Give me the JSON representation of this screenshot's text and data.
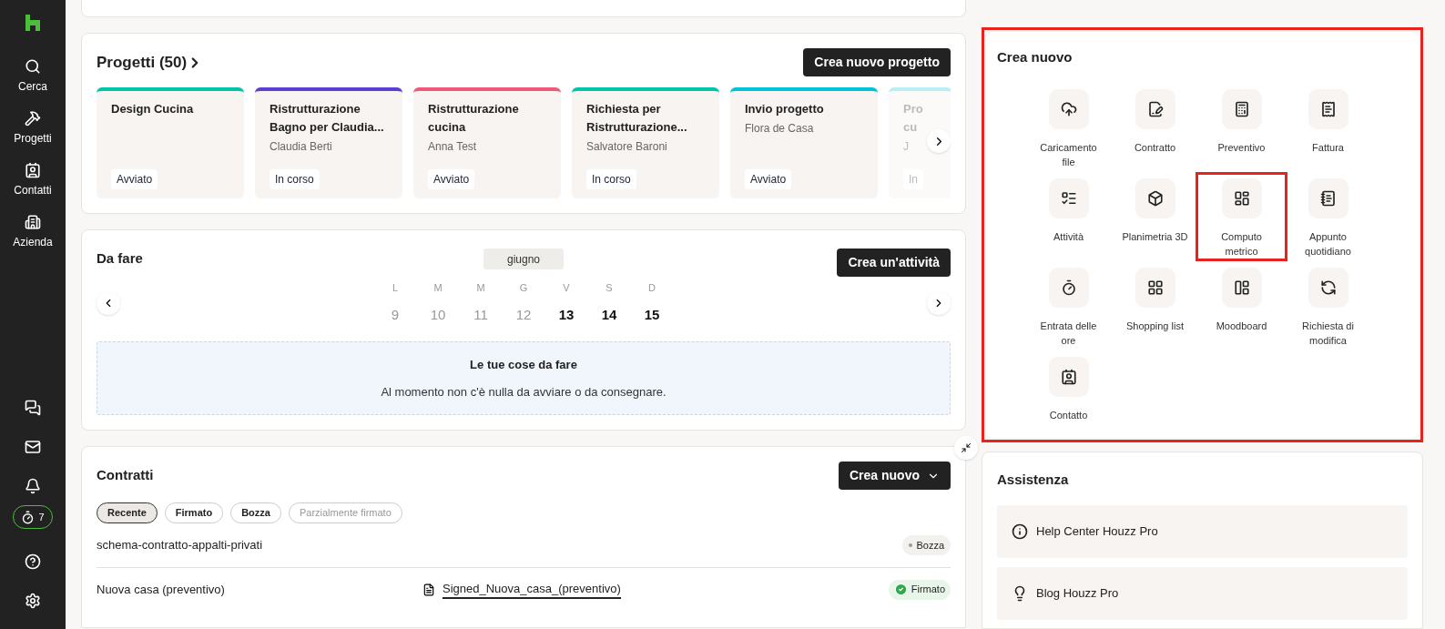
{
  "sidebar": {
    "items": [
      {
        "label": "Cerca"
      },
      {
        "label": "Progetti"
      },
      {
        "label": "Contatti"
      },
      {
        "label": "Azienda"
      }
    ],
    "timer_badge": "7"
  },
  "projects": {
    "title": "Progetti (50)",
    "button": "Crea nuovo progetto",
    "cards": [
      {
        "title": "Design Cucina",
        "status": "Avviato",
        "color": "#00c4a7",
        "faded": false
      },
      {
        "title": "Ristrutturazione Bagno per Claudia...",
        "client": "Claudia Berti",
        "status": "In corso",
        "color": "#5a3fd0",
        "faded": false
      },
      {
        "title": "Ristrutturazione cucina",
        "client": "Anna Test",
        "status": "Avviato",
        "color": "#f0587a",
        "faded": false
      },
      {
        "title": "Richiesta per Ristrutturazione...",
        "client": "Salvatore Baroni",
        "status": "In corso",
        "color": "#00c4a7",
        "faded": false
      },
      {
        "title": "Invio progetto",
        "client": "Flora de Casa",
        "status": "Avviato",
        "color": "#00c3da",
        "faded": false
      },
      {
        "title": "Pro cu",
        "client": "J",
        "status": "In",
        "color": "#b8eef4",
        "faded": true
      }
    ]
  },
  "todo": {
    "title": "Da fare",
    "month": "giugno",
    "button": "Crea un'attività",
    "days": [
      {
        "weekday": "L",
        "day": "9",
        "past": true
      },
      {
        "weekday": "M",
        "day": "10",
        "past": true
      },
      {
        "weekday": "M",
        "day": "11",
        "past": true
      },
      {
        "weekday": "G",
        "day": "12",
        "past": true
      },
      {
        "weekday": "V",
        "day": "13",
        "past": false
      },
      {
        "weekday": "S",
        "day": "14",
        "past": false
      },
      {
        "weekday": "D",
        "day": "15",
        "past": false
      }
    ],
    "empty_title": "Le tue cose da fare",
    "empty_text": "Al momento non c'è nulla da avviare o da consegnare."
  },
  "contracts": {
    "title": "Contratti",
    "button": "Crea nuovo",
    "filters": [
      {
        "label": "Recente",
        "selected": true,
        "disabled": false
      },
      {
        "label": "Firmato",
        "selected": false,
        "disabled": false
      },
      {
        "label": "Bozza",
        "selected": false,
        "disabled": false
      },
      {
        "label": "Parzialmente firmato",
        "selected": false,
        "disabled": true
      }
    ],
    "rows": [
      {
        "name": "schema-contratto-appalti-privati",
        "status": "Bozza",
        "kind": "draft"
      },
      {
        "name": "Nuova casa (preventivo)",
        "file": "Signed_Nuova_casa_(preventivo)",
        "status": "Firmato",
        "kind": "signed"
      }
    ]
  },
  "create_new": {
    "title": "Crea nuovo",
    "highlighted": true,
    "items": [
      {
        "label": "Caricamento file",
        "highlighted": false
      },
      {
        "label": "Contratto",
        "highlighted": false
      },
      {
        "label": "Preventivo",
        "highlighted": false
      },
      {
        "label": "Fattura",
        "highlighted": false
      },
      {
        "label": "Attività",
        "highlighted": false
      },
      {
        "label": "Planimetria 3D",
        "highlighted": false
      },
      {
        "label": "Computo metrico",
        "highlighted": true
      },
      {
        "label": "Appunto quotidiano",
        "highlighted": false
      },
      {
        "label": "Entrata delle ore",
        "highlighted": false
      },
      {
        "label": "Shopping list",
        "highlighted": false
      },
      {
        "label": "Moodboard",
        "highlighted": false
      },
      {
        "label": "Richiesta di modifica",
        "highlighted": false
      },
      {
        "label": "Contatto",
        "highlighted": false
      }
    ]
  },
  "support": {
    "title": "Assistenza",
    "links": [
      {
        "label": "Help Center Houzz Pro"
      },
      {
        "label": "Blog Houzz Pro"
      }
    ]
  }
}
